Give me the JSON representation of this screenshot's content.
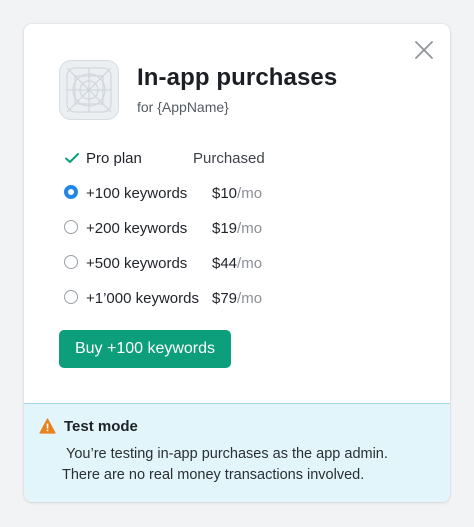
{
  "dialog": {
    "title": "In-app purchases",
    "subtitle": "for {AppName}"
  },
  "plans": [
    {
      "label": "Pro plan",
      "status": "Purchased",
      "owned": true
    },
    {
      "label": "+100 keywords",
      "price": "$10",
      "per": "/mo",
      "selected": true
    },
    {
      "label": "+200 keywords",
      "price": "$19",
      "per": "/mo",
      "selected": false
    },
    {
      "label": "+500 keywords",
      "price": "$44",
      "per": "/mo",
      "selected": false
    },
    {
      "label": "+1’000 keywords",
      "price": "$79",
      "per": "/mo",
      "selected": false
    }
  ],
  "buy_button": {
    "label": "Buy +100 keywords"
  },
  "notice": {
    "title": "Test mode",
    "line1": "You’re testing in-app purchases as the app admin.",
    "line2": "There are no real money transactions involved."
  },
  "colors": {
    "accent_green": "#0d9e7c",
    "radio_blue": "#2286e8",
    "check_green": "#0d9e7c",
    "notice_bg": "#e2f5fb",
    "warning_orange": "#e8821e"
  },
  "icons": {
    "close": "close-icon",
    "app": "app-placeholder-icon",
    "owned": "checkmark-icon",
    "warning": "warning-triangle-icon"
  }
}
